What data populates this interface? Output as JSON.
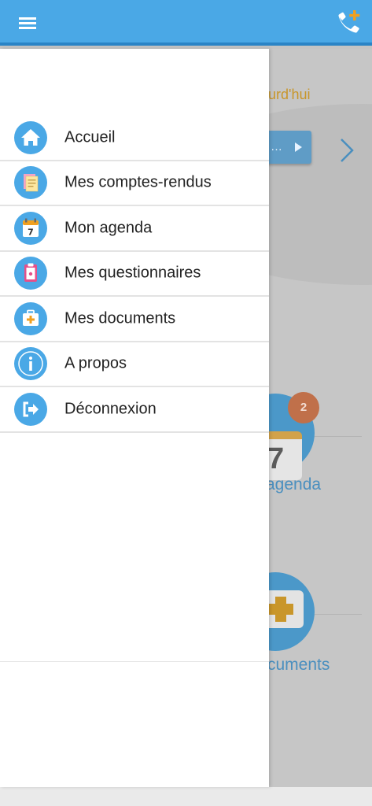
{
  "topbar": {
    "menu_icon": "hamburger-menu-icon",
    "call_icon": "phone-add-icon",
    "color": "#4aa8e6"
  },
  "background": {
    "today_fragment": "ourd'hui",
    "pill_text": "…",
    "agenda_badge": "2",
    "calendar_digit": "7",
    "agenda_label": "agenda",
    "documents_label": "cuments"
  },
  "menu": {
    "items": [
      {
        "label": "Accueil",
        "icon": "home-icon"
      },
      {
        "label": "Mes comptes-rendus",
        "icon": "document-stack-icon"
      },
      {
        "label": "Mon agenda",
        "icon": "calendar-icon"
      },
      {
        "label": "Mes questionnaires",
        "icon": "clipboard-icon"
      },
      {
        "label": "Mes documents",
        "icon": "medical-kit-icon"
      },
      {
        "label": "A propos",
        "icon": "info-icon"
      },
      {
        "label": "Déconnexion",
        "icon": "logout-icon"
      }
    ]
  },
  "colors": {
    "accent": "#4aa8e6",
    "badge": "#c0704a",
    "gold": "#c8962a"
  }
}
